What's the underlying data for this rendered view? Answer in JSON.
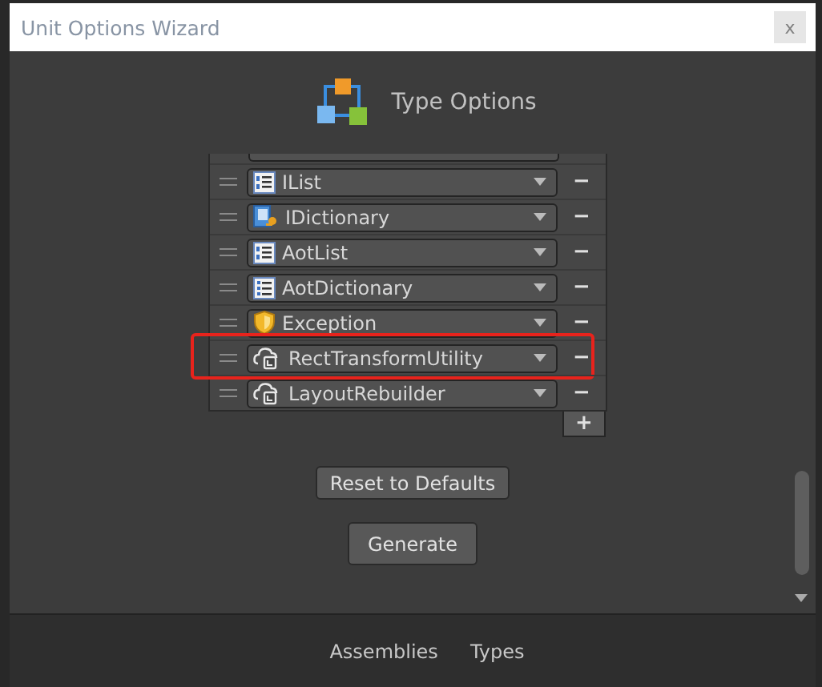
{
  "window": {
    "title": "Unit Options Wizard",
    "close": "x"
  },
  "header": {
    "title": "Type Options"
  },
  "types": [
    {
      "kind": "list",
      "label": "IList",
      "highlighted": false
    },
    {
      "kind": "dictionary",
      "label": "IDictionary",
      "highlighted": false
    },
    {
      "kind": "list",
      "label": "AotList",
      "highlighted": false
    },
    {
      "kind": "bulleted",
      "label": "AotDictionary",
      "highlighted": false
    },
    {
      "kind": "exception",
      "label": "Exception",
      "highlighted": false
    },
    {
      "kind": "class",
      "label": "RectTransformUtility",
      "highlighted": true
    },
    {
      "kind": "class",
      "label": "LayoutRebuilder",
      "highlighted": false
    }
  ],
  "list_buttons": {
    "remove": "−",
    "add": "+"
  },
  "buttons": [
    {
      "label": "Reset to Defaults"
    },
    {
      "label": "Generate"
    }
  ],
  "footer_tabs": [
    {
      "label": "Assemblies"
    },
    {
      "label": "Types"
    }
  ]
}
